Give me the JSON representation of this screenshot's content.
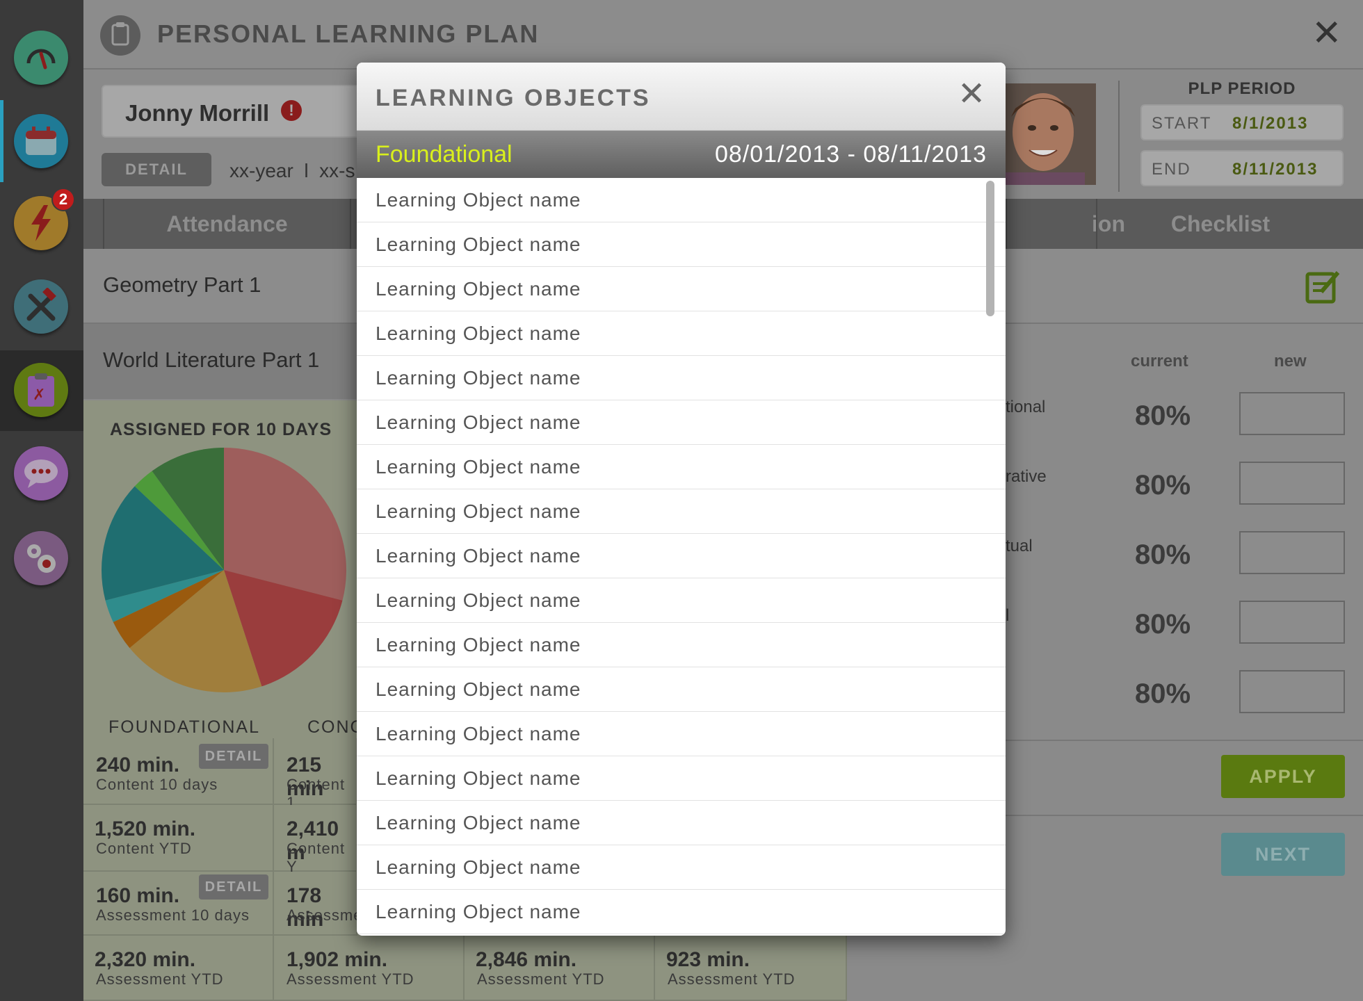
{
  "header": {
    "title": "PERSONAL LEARNING PLAN"
  },
  "nav": {
    "alerts_badge": "2"
  },
  "student": {
    "name": "Jonny Morrill",
    "detail_label": "DETAIL",
    "meta": "xx-year  l  xx-s"
  },
  "plp_period": {
    "label": "PLP PERIOD",
    "start_label": "START",
    "start_value": "8/1/2013",
    "end_label": "END",
    "end_value": "8/11/2013"
  },
  "tabs": [
    "Attendance",
    "ion",
    "Checklist"
  ],
  "courses": [
    "Geometry Part 1",
    "World Literature Part 1"
  ],
  "assigned": {
    "title": "ASSIGNED FOR 10 DAYS",
    "col_labels": [
      "FOUNDATIONAL",
      "CONC"
    ]
  },
  "stats": [
    {
      "value": "240 min.",
      "sub": "Content 10 days"
    },
    {
      "value": "215 min",
      "sub": "Content 1"
    },
    {
      "value": "1,520 min.",
      "sub": "Content YTD"
    },
    {
      "value": "2,410 m",
      "sub": "Content Y"
    },
    {
      "value": "160 min.",
      "sub": "Assessment 10 days"
    },
    {
      "value": "178 min",
      "sub": "Assessme"
    },
    {
      "value": "2,320 min.",
      "sub": "Assessment YTD"
    },
    {
      "value": "1,902 min.",
      "sub": "Assessment YTD"
    },
    {
      "value": "2,846 min.",
      "sub": "Assessment YTD"
    },
    {
      "value": "923 min.",
      "sub": "Assessment YTD"
    }
  ],
  "detail_label": "DETAIL",
  "percent_panel": {
    "current_label": "current",
    "new_label": "new",
    "rows": [
      {
        "label": "tional",
        "current": "80%"
      },
      {
        "label": "rative",
        "current": "80%"
      },
      {
        "label": "tual",
        "current": "80%"
      },
      {
        "label": "l",
        "current": "80%"
      },
      {
        "label": "",
        "current": "80%"
      }
    ],
    "apply_label": "APPLY",
    "next_label": "NEXT"
  },
  "modal": {
    "title": "LEARNING OBJECTS",
    "category": "Foundational",
    "date_range": "08/01/2013 - 08/11/2013",
    "items": [
      "Learning Object name",
      "Learning Object name",
      "Learning Object name",
      "Learning Object name",
      "Learning Object name",
      "Learning Object name",
      "Learning Object name",
      "Learning Object name",
      "Learning Object name",
      "Learning Object name",
      "Learning Object name",
      "Learning Object name",
      "Learning Object name",
      "Learning Object name",
      "Learning Object name",
      "Learning Object name",
      "Learning Object name"
    ]
  },
  "colors": {
    "accent_green": "#6e8d10",
    "category_yellow": "#d9f01c",
    "next_teal": "#5a8a8e",
    "badge_red": "#c11c1c"
  },
  "chart_data": {
    "type": "pie",
    "title": "ASSIGNED FOR 10 DAYS",
    "slices": [
      {
        "value": 29,
        "color": "#9e5e5c"
      },
      {
        "value": 16,
        "color": "#9a3d3d"
      },
      {
        "value": 19,
        "color": "#a07e3c"
      },
      {
        "value": 4,
        "color": "#9a5a0e"
      },
      {
        "value": 3,
        "color": "#2f8c8c"
      },
      {
        "value": 16,
        "color": "#1f6e70"
      },
      {
        "value": 3,
        "color": "#4e9a3a"
      },
      {
        "value": 10,
        "color": "#3a6e3a"
      }
    ]
  }
}
